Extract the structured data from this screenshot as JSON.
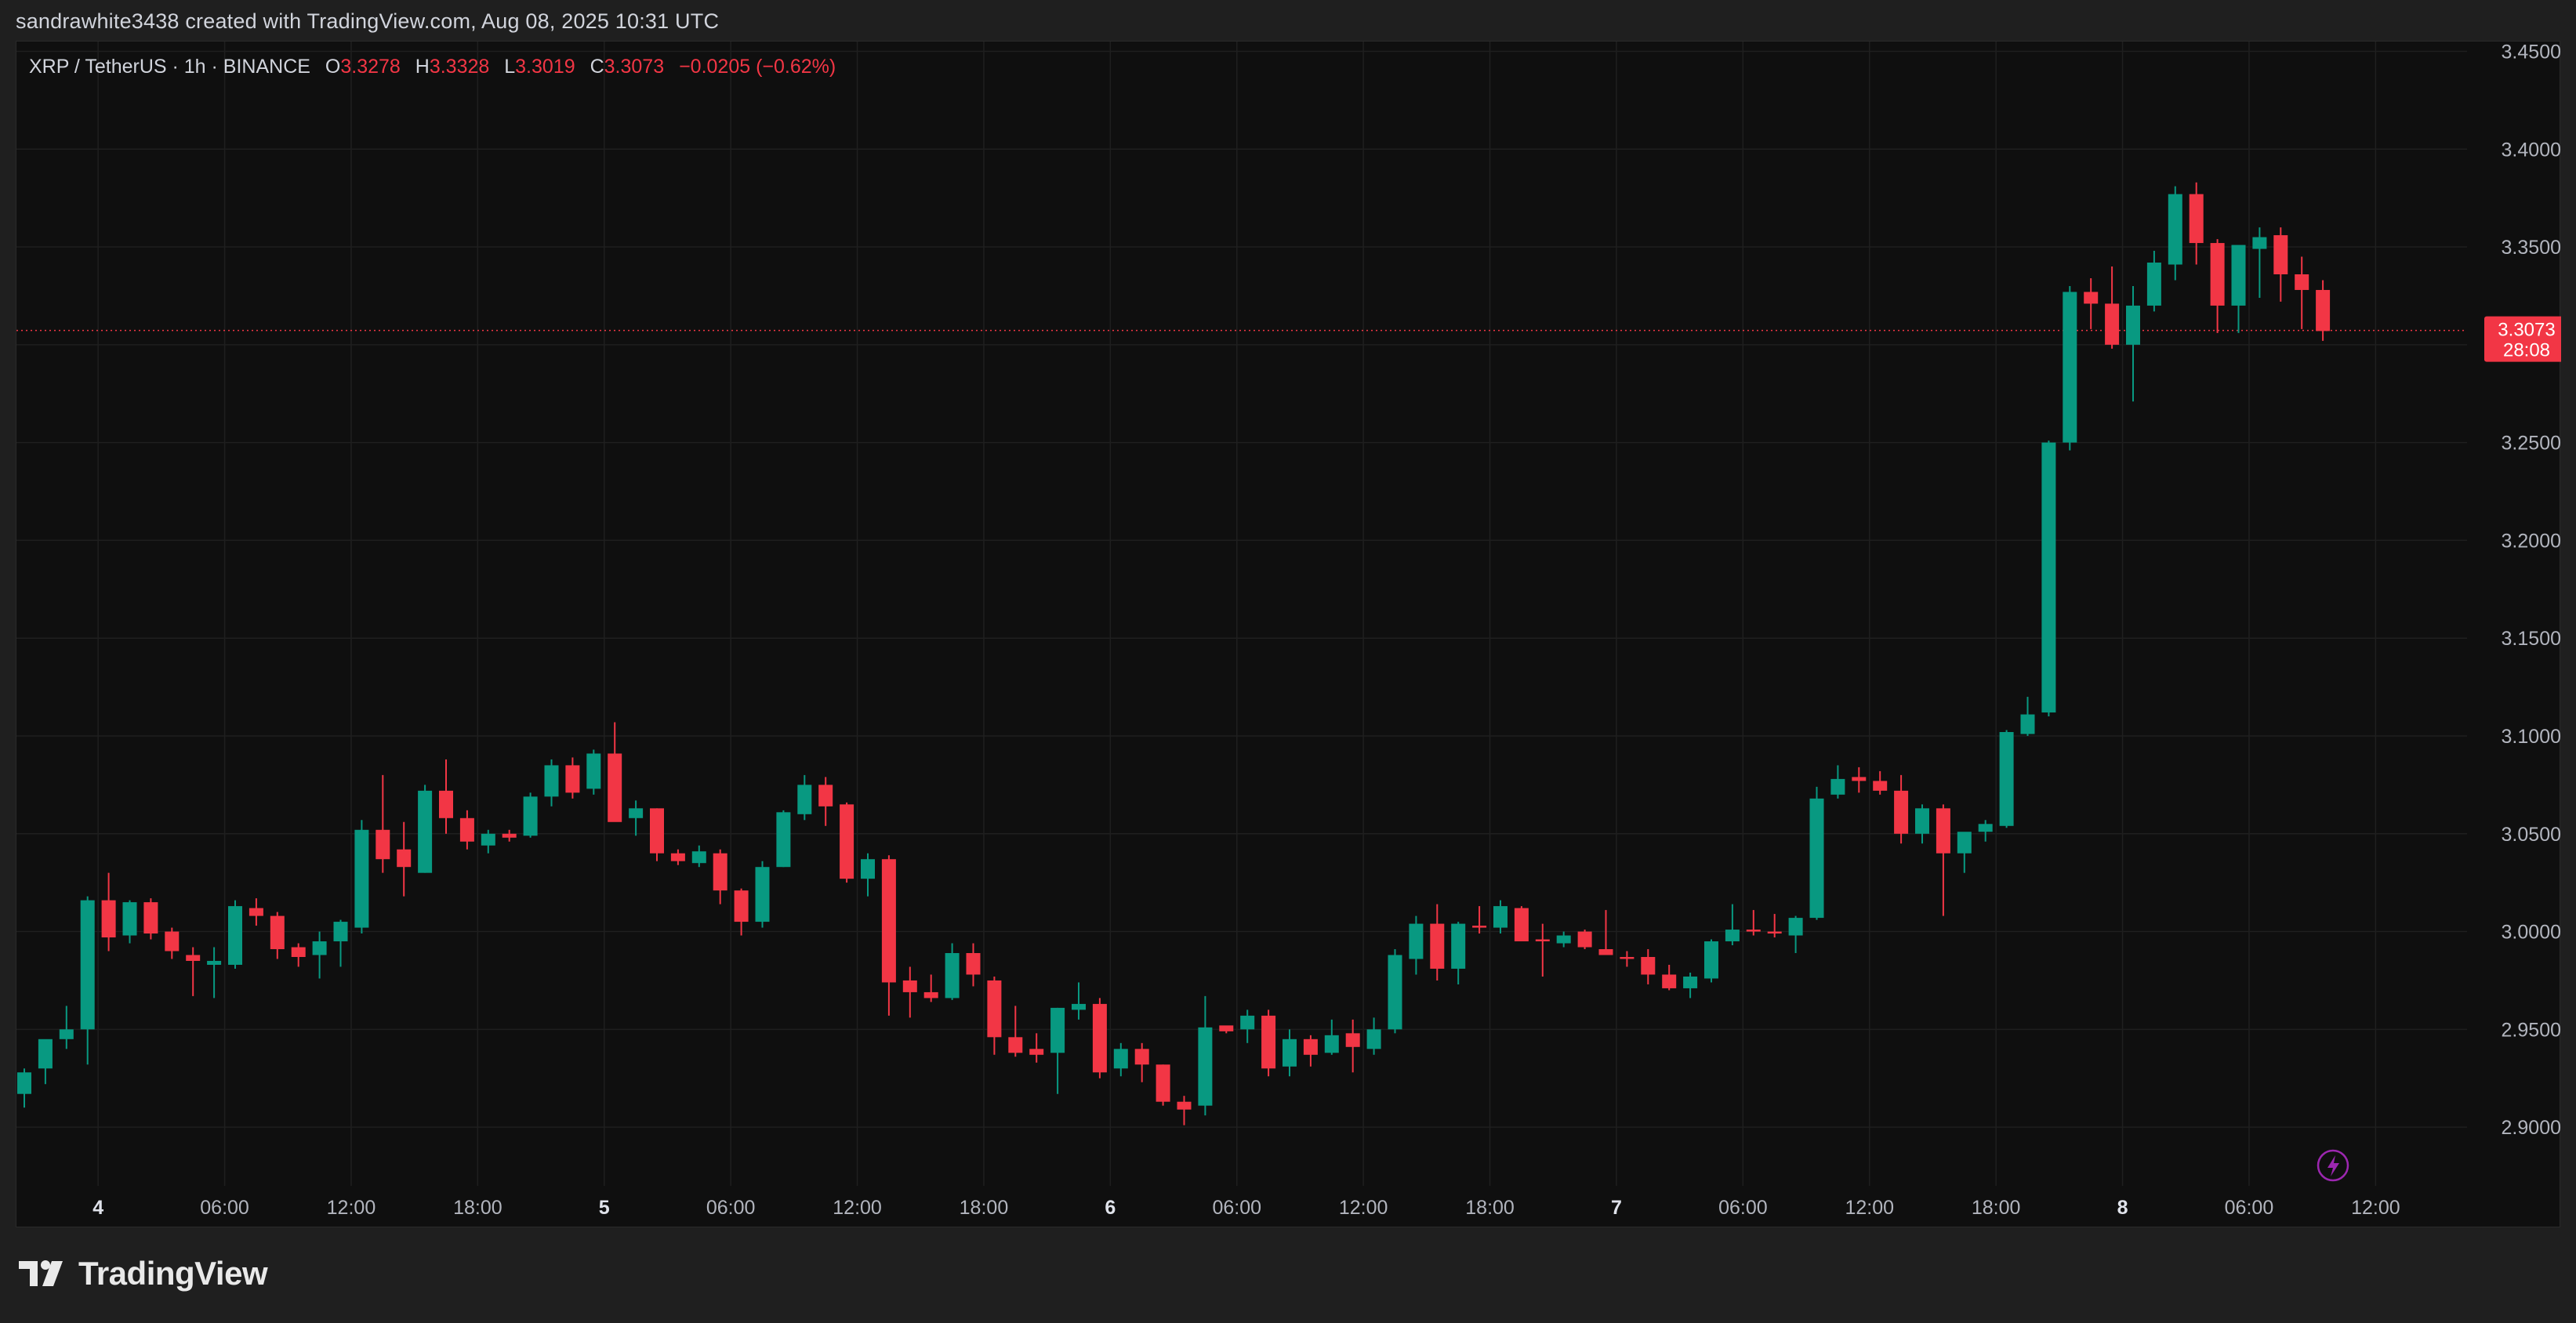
{
  "credit": "sandrawhite3438 created with TradingView.com, Aug 08, 2025 10:31 UTC",
  "legend": {
    "symbol": "XRP / TetherUS · 1h · BINANCE",
    "o_label": "O",
    "o_value": "3.3278",
    "h_label": "H",
    "h_value": "3.3328",
    "l_label": "L",
    "l_value": "3.3019",
    "c_label": "C",
    "c_value": "3.3073",
    "change": "−0.0205 (−0.62%)"
  },
  "price_badge": {
    "price": "3.3073",
    "countdown": "28:08"
  },
  "footer": {
    "brand": "TradingView"
  },
  "colors": {
    "up": "#089981",
    "down": "#f23645",
    "background": "#0f0f0f",
    "grid": "#1f1f1f",
    "text": "#d1d4dc",
    "bolt": "#9c27b0"
  },
  "icons": {
    "logo": "tradingview-logo-icon",
    "bolt": "lightning-bolt-icon"
  },
  "chart_data": {
    "type": "candlestick",
    "title": "XRP / TetherUS · 1h · BINANCE",
    "grid": true,
    "ylim": [
      2.87,
      3.455
    ],
    "y_ticks": [
      "3.4500",
      "3.4000",
      "3.3500",
      "3.3000",
      "3.2500",
      "3.2000",
      "3.1500",
      "3.1000",
      "3.0500",
      "3.0000",
      "2.9500",
      "2.9000"
    ],
    "x_ticks": [
      {
        "index": 3.5,
        "label": "4"
      },
      {
        "index": 9.5,
        "label": "06:00"
      },
      {
        "index": 15.5,
        "label": "12:00"
      },
      {
        "index": 21.5,
        "label": "18:00"
      },
      {
        "index": 27.5,
        "label": "5"
      },
      {
        "index": 33.5,
        "label": "06:00"
      },
      {
        "index": 39.5,
        "label": "12:00"
      },
      {
        "index": 45.5,
        "label": "18:00"
      },
      {
        "index": 51.5,
        "label": "6"
      },
      {
        "index": 57.5,
        "label": "06:00"
      },
      {
        "index": 63.5,
        "label": "12:00"
      },
      {
        "index": 69.5,
        "label": "18:00"
      },
      {
        "index": 75.5,
        "label": "7"
      },
      {
        "index": 81.5,
        "label": "06:00"
      },
      {
        "index": 87.5,
        "label": "12:00"
      },
      {
        "index": 93.5,
        "label": "18:00"
      },
      {
        "index": 99.5,
        "label": "8"
      },
      {
        "index": 105.5,
        "label": "06:00"
      },
      {
        "index": 111.5,
        "label": "12:00"
      }
    ],
    "last_price": 3.3073,
    "candles": [
      [
        2.917,
        2.93,
        2.91,
        2.928
      ],
      [
        2.93,
        2.942,
        2.922,
        2.945
      ],
      [
        2.945,
        2.962,
        2.94,
        2.95
      ],
      [
        2.95,
        3.018,
        2.932,
        3.016
      ],
      [
        3.016,
        3.03,
        2.99,
        2.997
      ],
      [
        2.998,
        3.016,
        2.994,
        3.015
      ],
      [
        3.015,
        3.017,
        2.996,
        2.999
      ],
      [
        3.0,
        3.002,
        2.986,
        2.99
      ],
      [
        2.988,
        2.992,
        2.967,
        2.985
      ],
      [
        2.983,
        2.992,
        2.966,
        2.985
      ],
      [
        2.983,
        3.016,
        2.981,
        3.013
      ],
      [
        3.012,
        3.017,
        3.003,
        3.008
      ],
      [
        3.008,
        3.01,
        2.986,
        2.991
      ],
      [
        2.992,
        2.994,
        2.982,
        2.987
      ],
      [
        2.988,
        3.0,
        2.976,
        2.995
      ],
      [
        2.995,
        3.006,
        2.982,
        3.005
      ],
      [
        3.002,
        3.057,
        2.999,
        3.052
      ],
      [
        3.052,
        3.08,
        3.03,
        3.037
      ],
      [
        3.042,
        3.056,
        3.018,
        3.033
      ],
      [
        3.03,
        3.075,
        3.03,
        3.072
      ],
      [
        3.072,
        3.088,
        3.05,
        3.058
      ],
      [
        3.058,
        3.062,
        3.042,
        3.046
      ],
      [
        3.044,
        3.052,
        3.04,
        3.05
      ],
      [
        3.05,
        3.052,
        3.046,
        3.048
      ],
      [
        3.049,
        3.071,
        3.048,
        3.069
      ],
      [
        3.069,
        3.088,
        3.064,
        3.085
      ],
      [
        3.085,
        3.089,
        3.068,
        3.071
      ],
      [
        3.073,
        3.093,
        3.07,
        3.091
      ],
      [
        3.091,
        3.107,
        3.058,
        3.056
      ],
      [
        3.058,
        3.067,
        3.049,
        3.063
      ],
      [
        3.063,
        3.063,
        3.036,
        3.04
      ],
      [
        3.04,
        3.042,
        3.034,
        3.036
      ],
      [
        3.035,
        3.044,
        3.033,
        3.041
      ],
      [
        3.04,
        3.042,
        3.014,
        3.021
      ],
      [
        3.021,
        3.022,
        2.998,
        3.005
      ],
      [
        3.005,
        3.036,
        3.002,
        3.033
      ],
      [
        3.033,
        3.062,
        3.033,
        3.061
      ],
      [
        3.06,
        3.08,
        3.057,
        3.075
      ],
      [
        3.075,
        3.079,
        3.054,
        3.064
      ],
      [
        3.065,
        3.066,
        3.025,
        3.027
      ],
      [
        3.027,
        3.04,
        3.018,
        3.037
      ],
      [
        3.037,
        3.039,
        2.957,
        2.974
      ],
      [
        2.975,
        2.982,
        2.956,
        2.969
      ],
      [
        2.969,
        2.978,
        2.964,
        2.966
      ],
      [
        2.966,
        2.994,
        2.965,
        2.989
      ],
      [
        2.989,
        2.994,
        2.972,
        2.978
      ],
      [
        2.975,
        2.977,
        2.937,
        2.946
      ],
      [
        2.946,
        2.962,
        2.936,
        2.938
      ],
      [
        2.94,
        2.948,
        2.933,
        2.937
      ],
      [
        2.938,
        2.961,
        2.917,
        2.961
      ],
      [
        2.96,
        2.974,
        2.955,
        2.963
      ],
      [
        2.963,
        2.966,
        2.925,
        2.928
      ],
      [
        2.93,
        2.943,
        2.926,
        2.94
      ],
      [
        2.94,
        2.943,
        2.923,
        2.932
      ],
      [
        2.932,
        2.932,
        2.911,
        2.913
      ],
      [
        2.913,
        2.916,
        2.901,
        2.909
      ],
      [
        2.911,
        2.967,
        2.906,
        2.951
      ],
      [
        2.952,
        2.951,
        2.948,
        2.949
      ],
      [
        2.95,
        2.96,
        2.943,
        2.957
      ],
      [
        2.957,
        2.96,
        2.926,
        2.93
      ],
      [
        2.931,
        2.95,
        2.926,
        2.945
      ],
      [
        2.945,
        2.947,
        2.931,
        2.937
      ],
      [
        2.938,
        2.955,
        2.937,
        2.947
      ],
      [
        2.948,
        2.955,
        2.928,
        2.941
      ],
      [
        2.94,
        2.956,
        2.937,
        2.95
      ],
      [
        2.95,
        2.991,
        2.948,
        2.988
      ],
      [
        2.986,
        3.008,
        2.978,
        3.004
      ],
      [
        3.004,
        3.014,
        2.975,
        2.981
      ],
      [
        2.981,
        3.005,
        2.973,
        3.004
      ],
      [
        3.003,
        3.013,
        2.999,
        3.002
      ],
      [
        3.002,
        3.016,
        2.999,
        3.013
      ],
      [
        3.012,
        3.013,
        2.996,
        2.995
      ],
      [
        2.996,
        3.004,
        2.977,
        2.995
      ],
      [
        2.994,
        3.0,
        2.992,
        2.998
      ],
      [
        3.0,
        3.001,
        2.991,
        2.992
      ],
      [
        2.991,
        3.011,
        2.988,
        2.988
      ],
      [
        2.987,
        2.99,
        2.982,
        2.986
      ],
      [
        2.987,
        2.991,
        2.973,
        2.978
      ],
      [
        2.978,
        2.983,
        2.97,
        2.971
      ],
      [
        2.971,
        2.979,
        2.966,
        2.977
      ],
      [
        2.976,
        2.996,
        2.974,
        2.995
      ],
      [
        2.995,
        3.014,
        2.993,
        3.001
      ],
      [
        3.001,
        3.011,
        2.998,
        3.0
      ],
      [
        3.0,
        3.009,
        2.997,
        2.999
      ],
      [
        2.998,
        3.008,
        2.989,
        3.007
      ],
      [
        3.007,
        3.074,
        3.006,
        3.068
      ],
      [
        3.07,
        3.085,
        3.068,
        3.078
      ],
      [
        3.079,
        3.084,
        3.071,
        3.077
      ],
      [
        3.077,
        3.082,
        3.07,
        3.072
      ],
      [
        3.072,
        3.08,
        3.045,
        3.05
      ],
      [
        3.05,
        3.065,
        3.045,
        3.063
      ],
      [
        3.063,
        3.065,
        3.008,
        3.04
      ],
      [
        3.04,
        3.05,
        3.03,
        3.051
      ],
      [
        3.051,
        3.057,
        3.046,
        3.055
      ],
      [
        3.054,
        3.103,
        3.053,
        3.102
      ],
      [
        3.101,
        3.12,
        3.1,
        3.111
      ],
      [
        3.112,
        3.251,
        3.11,
        3.25
      ],
      [
        3.25,
        3.33,
        3.246,
        3.327
      ],
      [
        3.327,
        3.334,
        3.308,
        3.321
      ],
      [
        3.321,
        3.34,
        3.298,
        3.3
      ],
      [
        3.3,
        3.33,
        3.271,
        3.32
      ],
      [
        3.32,
        3.348,
        3.317,
        3.342
      ],
      [
        3.341,
        3.381,
        3.333,
        3.377
      ],
      [
        3.377,
        3.383,
        3.341,
        3.352
      ],
      [
        3.352,
        3.354,
        3.306,
        3.32
      ],
      [
        3.32,
        3.349,
        3.306,
        3.351
      ],
      [
        3.349,
        3.36,
        3.324,
        3.355
      ],
      [
        3.356,
        3.36,
        3.322,
        3.336
      ],
      [
        3.336,
        3.345,
        3.308,
        3.328
      ],
      [
        3.328,
        3.333,
        3.302,
        3.307
      ]
    ]
  }
}
